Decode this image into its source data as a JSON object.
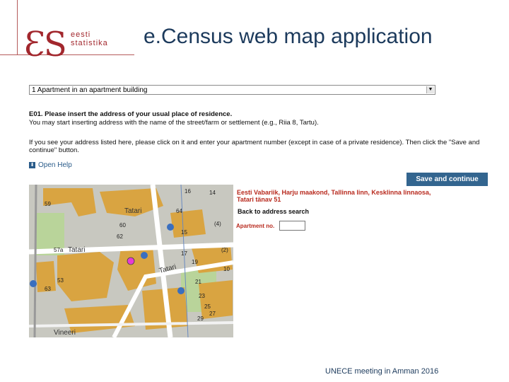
{
  "header": {
    "logo_mark": "ƐS",
    "logo_line1": "eesti",
    "logo_line2": "statistika",
    "title": "e.Census web map application"
  },
  "form": {
    "dwelling_type": "1 Apartment in an apartment building",
    "question_code": "E01. Please insert the address of your usual place of residence.",
    "question_hint": "You may start inserting address with the name of the street/farm or settlement (e.g., Riia 8, Tartu).",
    "instruction": "If you see your address listed here, please click on it and enter your apartment number (except in case of a private residence). Then click the \"Save and continue\" button.",
    "help_label": "Open Help",
    "save_label": "Save and continue"
  },
  "map": {
    "street_labels": [
      "Tatari",
      "Tatari",
      "Vineeri",
      "Tatari"
    ],
    "house_numbers": [
      "16",
      "14",
      "59",
      "60",
      "62",
      "57a",
      "53",
      "63",
      "64",
      "15",
      "17",
      "19",
      "21",
      "23",
      "25",
      "27",
      "29",
      "10",
      "(2)",
      "(4)"
    ]
  },
  "result": {
    "address": "Eesti Vabariik, Harju maakond, Tallinna linn, Kesklinna linnaosa, Tatari tänav 51",
    "back_link": "Back to address search",
    "apartment_label": "Apartment no.",
    "apartment_value": ""
  },
  "footer": {
    "text": "UNECE meeting in Amman 2016"
  },
  "colors": {
    "brand": "#a2272d",
    "title": "#1c3a5c",
    "button": "#33658f",
    "address": "#b82a1e",
    "map_building": "#d9a441",
    "map_bg": "#c8c8c0"
  }
}
